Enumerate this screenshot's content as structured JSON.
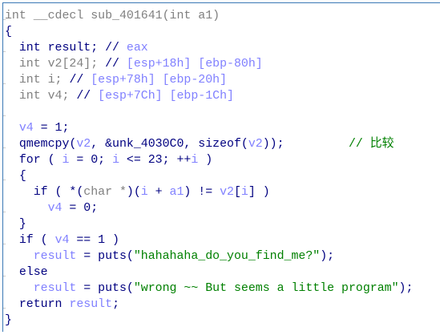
{
  "pseudocode_view": {
    "colors": {
      "keyword": "#000080",
      "variable": "#8080ff",
      "string": "#008000",
      "comment": "#008000",
      "muted": "#808080",
      "border": "#3a78b5"
    },
    "lines": [
      [
        [
          "hdr",
          "int __cdecl sub_401641(int a1)"
        ]
      ],
      [
        [
          "kw",
          "{"
        ]
      ],
      [
        [
          "kw",
          "  int result; // "
        ],
        [
          "var",
          "eax"
        ]
      ],
      [
        [
          "gray",
          "  int v2[24]; "
        ],
        [
          "kw",
          "// "
        ],
        [
          "var",
          "[esp+18h] [ebp-80h]"
        ]
      ],
      [
        [
          "gray",
          "  int i; "
        ],
        [
          "kw",
          "// "
        ],
        [
          "var",
          "[esp+78h] [ebp-20h]"
        ]
      ],
      [
        [
          "gray",
          "  int v4; "
        ],
        [
          "kw",
          "// "
        ],
        [
          "var",
          "[esp+7Ch] [ebp-1Ch]"
        ]
      ],
      [
        [
          "kw",
          ""
        ]
      ],
      [
        [
          "kw",
          "  "
        ],
        [
          "var",
          "v4"
        ],
        [
          "kw",
          " = 1;"
        ]
      ],
      [
        [
          "kw",
          "  qmemcpy("
        ],
        [
          "var",
          "v2"
        ],
        [
          "kw",
          ", &unk_4030C0, sizeof("
        ],
        [
          "var",
          "v2"
        ],
        [
          "kw",
          "));         "
        ],
        [
          "cmt",
          "// 比较"
        ]
      ],
      [
        [
          "kw",
          "  for ( "
        ],
        [
          "var",
          "i"
        ],
        [
          "kw",
          " = 0; "
        ],
        [
          "var",
          "i"
        ],
        [
          "kw",
          " <= 23; ++"
        ],
        [
          "var",
          "i"
        ],
        [
          "kw",
          " )"
        ]
      ],
      [
        [
          "kw",
          "  {"
        ]
      ],
      [
        [
          "kw",
          "    if ( *("
        ],
        [
          "gray",
          "char *"
        ],
        [
          "kw",
          ")("
        ],
        [
          "var",
          "i"
        ],
        [
          "kw",
          " + "
        ],
        [
          "var",
          "a1"
        ],
        [
          "kw",
          ") != "
        ],
        [
          "var",
          "v2"
        ],
        [
          "kw",
          "["
        ],
        [
          "var",
          "i"
        ],
        [
          "kw",
          "] )"
        ]
      ],
      [
        [
          "kw",
          "      "
        ],
        [
          "var",
          "v4"
        ],
        [
          "kw",
          " = 0;"
        ]
      ],
      [
        [
          "kw",
          "  }"
        ]
      ],
      [
        [
          "kw",
          "  if ( "
        ],
        [
          "var",
          "v4"
        ],
        [
          "kw",
          " == 1 )"
        ]
      ],
      [
        [
          "kw",
          "    "
        ],
        [
          "var",
          "result"
        ],
        [
          "kw",
          " = puts("
        ],
        [
          "str",
          "\"hahahaha_do_you_find_me?\""
        ],
        [
          "kw",
          ");"
        ]
      ],
      [
        [
          "kw",
          "  else"
        ]
      ],
      [
        [
          "kw",
          "    "
        ],
        [
          "var",
          "result"
        ],
        [
          "kw",
          " = puts("
        ],
        [
          "str",
          "\"wrong ~~ But seems a little program\""
        ],
        [
          "kw",
          ");"
        ]
      ],
      [
        [
          "kw",
          "  return "
        ],
        [
          "var",
          "result"
        ],
        [
          "kw",
          ";"
        ]
      ],
      [
        [
          "kw",
          "}"
        ]
      ]
    ]
  }
}
